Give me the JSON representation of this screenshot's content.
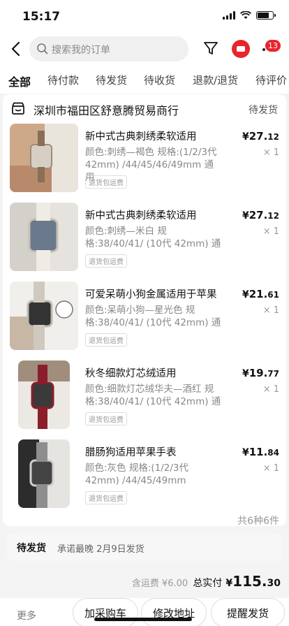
{
  "status_bar": {
    "time": "15:17"
  },
  "search": {
    "placeholder": "搜索我的订单"
  },
  "header": {
    "badge_count": "13"
  },
  "tabs": [
    {
      "label": "全部",
      "active": true
    },
    {
      "label": "待付款"
    },
    {
      "label": "待发货"
    },
    {
      "label": "待收货"
    },
    {
      "label": "退款/退货"
    },
    {
      "label": "待评价"
    }
  ],
  "shop": {
    "name": "深圳市福田区舒意腾贸易商行",
    "status": "待发货"
  },
  "items": [
    {
      "title": "新中式古典刺绣柔软适用",
      "spec": "颜色:刺绣—褐色 规格:(1/2/3代 42mm) /44/45/46/49mm 通用",
      "tag": "退货包运费",
      "price_symbol": "¥",
      "price_int": "27.",
      "price_dec": "12",
      "qty": "× 1"
    },
    {
      "title": "新中式古典刺绣柔软适用",
      "spec": "颜色:刺绣—米白 规格:38/40/41/ (10代 42mm) 通",
      "tag": "退货包运费",
      "price_symbol": "¥",
      "price_int": "27.",
      "price_dec": "12",
      "qty": "× 1"
    },
    {
      "title": "可爱呆萌小狗金属适用于苹果",
      "spec": "颜色:呆萌小狗—星光色 规格:38/40/41/ (10代 42mm) 通",
      "tag": "退货包运费",
      "price_symbol": "¥",
      "price_int": "21.",
      "price_dec": "61",
      "qty": "× 1"
    },
    {
      "title": "秋冬细款灯芯绒适用",
      "spec": "颜色:细款灯芯绒华夫—酒红 规格:38/40/41/ (10代 42mm) 通",
      "tag": "退货包运费",
      "price_symbol": "¥",
      "price_int": "19.",
      "price_dec": "77",
      "qty": "× 1"
    },
    {
      "title": "腊肠狗适用苹果手表",
      "spec": "颜色:灰色 规格:(1/2/3代 42mm) /44/45/49mm",
      "tag": "退货包运费",
      "price_symbol": "¥",
      "price_int": "11.",
      "price_dec": "84",
      "qty": "× 1"
    }
  ],
  "summary": {
    "count_text": "共6种6件"
  },
  "shipping": {
    "label": "待发货",
    "note": "承诺最晚 2月9日发货"
  },
  "total": {
    "shipping_fee_label": "含运费 ¥6.00",
    "paid_label": "总实付",
    "symbol": "¥",
    "amount_int": "115.",
    "amount_dec": "30"
  },
  "actions": {
    "more": "更多",
    "add_cart": "加采购车",
    "change_address": "修改地址",
    "remind_ship": "提醒发货"
  },
  "colors": {
    "accent": "#e8252d",
    "muted": "#888888"
  }
}
